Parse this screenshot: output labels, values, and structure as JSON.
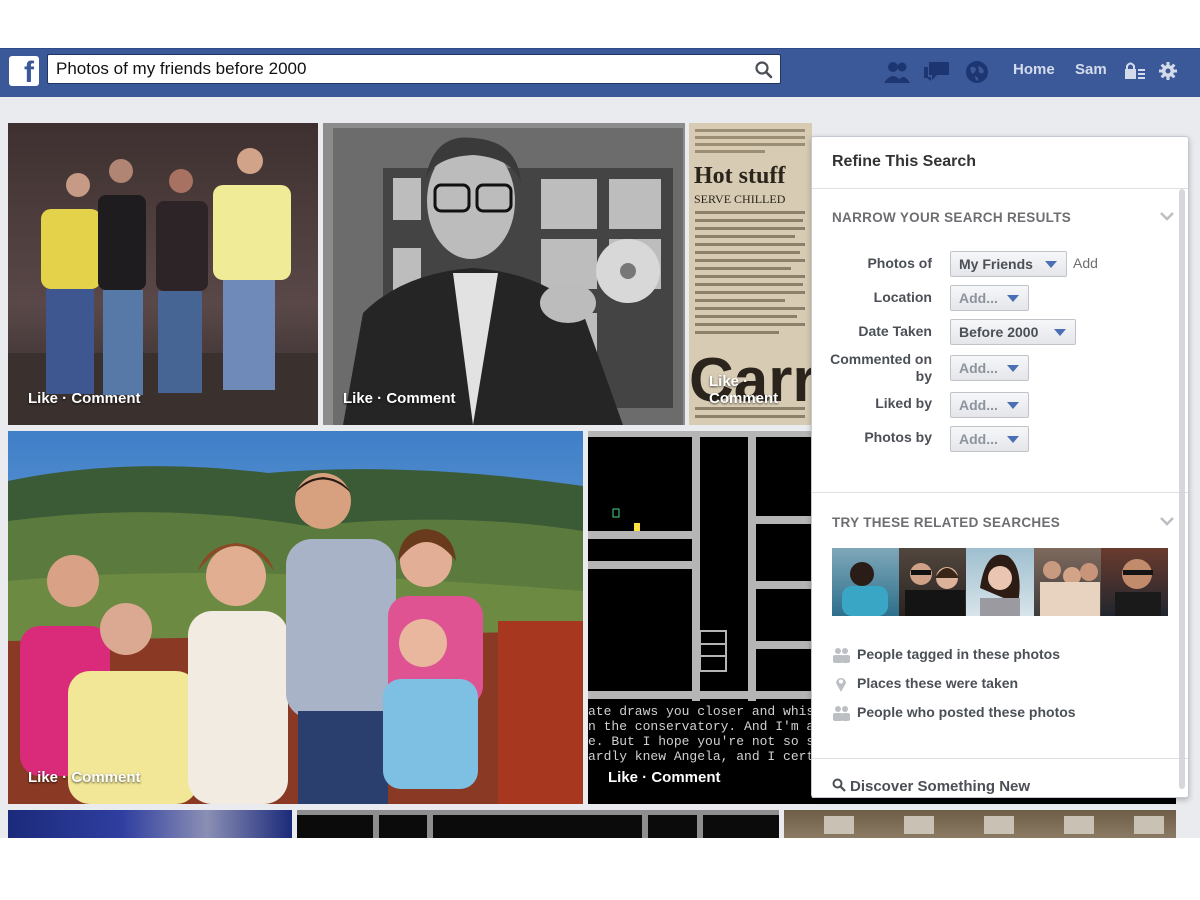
{
  "search": {
    "query": "Photos of my friends before 2000"
  },
  "nav": {
    "home": "Home",
    "user": "Sam"
  },
  "photos": {
    "caption": "Like · Comment",
    "newspaper_headline": "Hot stuff",
    "newspaper_lead": "SERVE CHILLED",
    "terminal_lines": [
      "ate draws you closer and whisp",
      "n the conservatory.  And I'm a",
      "e.  But I hope you're not so s",
      "ardly knew Angela, and I certa"
    ]
  },
  "panel": {
    "title": "Refine This Search",
    "narrow_heading": "NARROW YOUR SEARCH RESULTS",
    "filters": [
      {
        "label": "Photos of",
        "value": "My Friends"
      },
      {
        "label": "Location",
        "value": "Add..."
      },
      {
        "label": "Date Taken",
        "value": "Before 2000"
      },
      {
        "label": "Commented on by",
        "value": "Add..."
      },
      {
        "label": "Liked by",
        "value": "Add..."
      },
      {
        "label": "Photos by",
        "value": "Add..."
      }
    ],
    "add_label": "Add",
    "related_heading": "TRY THESE RELATED SEARCHES",
    "related": [
      "People tagged in these photos",
      "Places these were taken",
      "People who posted these photos"
    ],
    "discover": "Discover Something New"
  },
  "colors": {
    "brand": "#3b5998",
    "panel_border": "#c4c9d4"
  }
}
